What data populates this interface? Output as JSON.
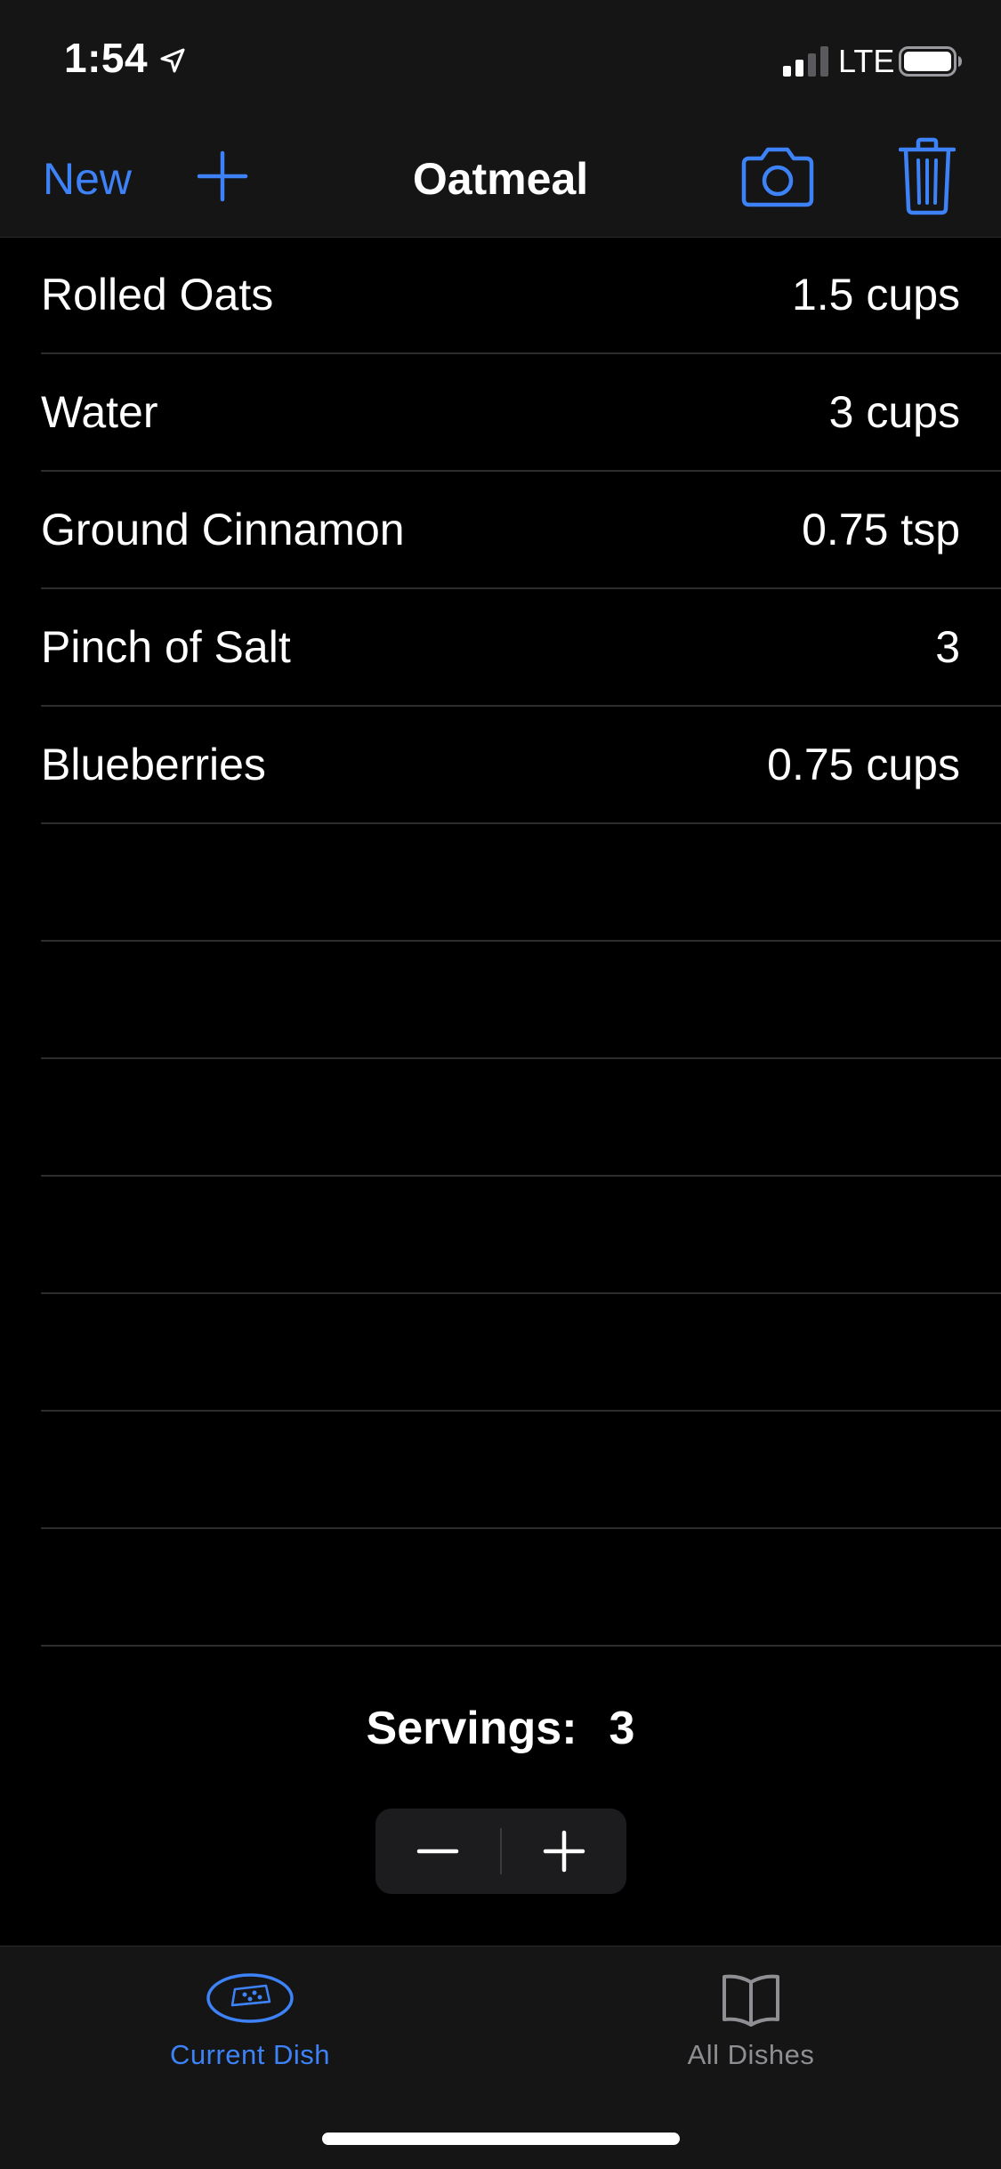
{
  "status_bar": {
    "time": "1:54",
    "network": "LTE",
    "icons": [
      "location-arrow-icon",
      "cellular-signal-icon",
      "battery-icon"
    ]
  },
  "nav": {
    "new_label": "New",
    "title": "Oatmeal",
    "icons": [
      "plus-icon",
      "camera-icon",
      "trash-icon"
    ],
    "accent_color": "#3e82f7"
  },
  "ingredients": [
    {
      "name": "Rolled Oats",
      "qty": "1.5 cups"
    },
    {
      "name": "Water",
      "qty": "3 cups"
    },
    {
      "name": "Ground Cinnamon",
      "qty": "0.75 tsp"
    },
    {
      "name": "Pinch of Salt",
      "qty": "3"
    },
    {
      "name": "Blueberries",
      "qty": "0.75 cups"
    },
    {
      "name": "",
      "qty": ""
    },
    {
      "name": "",
      "qty": ""
    },
    {
      "name": "",
      "qty": ""
    },
    {
      "name": "",
      "qty": ""
    },
    {
      "name": "",
      "qty": ""
    },
    {
      "name": "",
      "qty": ""
    },
    {
      "name": "",
      "qty": ""
    }
  ],
  "servings": {
    "label": "Servings:",
    "value": "3",
    "stepper_icons": [
      "minus-icon",
      "plus-icon"
    ]
  },
  "tabs": [
    {
      "label": "Current Dish",
      "icon": "dish-icon",
      "selected": true
    },
    {
      "label": "All Dishes",
      "icon": "book-icon",
      "selected": false
    }
  ]
}
